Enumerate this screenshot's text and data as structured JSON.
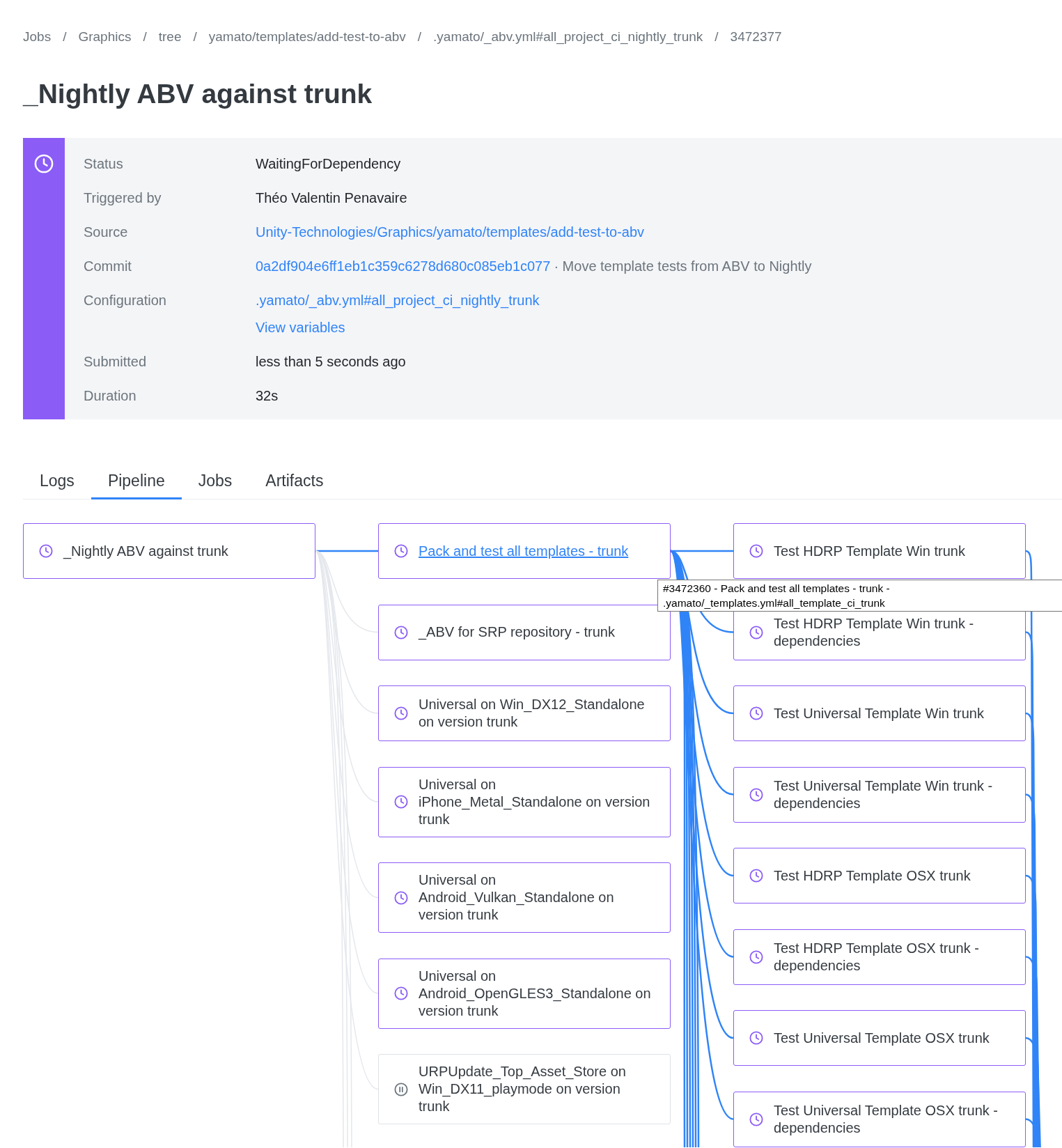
{
  "breadcrumb": [
    {
      "label": "Jobs"
    },
    {
      "separator": "/",
      "label": "Graphics"
    },
    {
      "separator": "/",
      "label": "tree"
    },
    {
      "separator": "/",
      "label": "yamato/templates/add-test-to-abv"
    },
    {
      "separator": "/",
      "label": ".yamato/_abv.yml#all_project_ci_nightly_trunk"
    },
    {
      "separator": "/",
      "label": "3472377"
    }
  ],
  "title": "_Nightly ABV against trunk",
  "summary": {
    "kind": "waiting",
    "rows": [
      {
        "label": "Status",
        "parts": [
          {
            "kind": "text",
            "text": "WaitingForDependency"
          }
        ]
      },
      {
        "label": "Triggered by",
        "parts": [
          {
            "kind": "text",
            "text": "Théo Valentin Penavaire"
          }
        ]
      },
      {
        "label": "Source",
        "parts": [
          {
            "kind": "link",
            "text": "Unity-Technologies/Graphics/yamato/templates/add-test-to-abv"
          }
        ]
      },
      {
        "label": "Commit",
        "parts": [
          {
            "kind": "link",
            "text": "0a2df904e6ff1eb1c359c6278d680c085eb1c077"
          },
          {
            "kind": "note",
            "text": "· Move template tests from ABV to Nightly"
          }
        ]
      },
      {
        "label": "Configuration",
        "parts": [
          {
            "kind": "link",
            "text": ".yamato/_abv.yml#all_project_ci_nightly_trunk"
          },
          {
            "kind": "link_below",
            "text": "View variables"
          }
        ]
      },
      {
        "label": "Submitted",
        "parts": [
          {
            "kind": "text",
            "text": "less than 5 seconds ago"
          }
        ]
      },
      {
        "label": "Duration",
        "parts": [
          {
            "kind": "text",
            "text": "32s"
          }
        ]
      }
    ]
  },
  "tabs": [
    {
      "label": "Logs",
      "selected": false
    },
    {
      "label": "Pipeline",
      "selected": true
    },
    {
      "label": "Jobs",
      "selected": false
    },
    {
      "label": "Artifacts",
      "selected": false
    }
  ],
  "pipeline": {
    "columns": [
      {
        "nodes": [
          {
            "label": "_Nightly ABV against trunk",
            "kind": "waiting",
            "highlighted": false
          }
        ]
      },
      {
        "nodes": [
          {
            "label": "Pack and test all templates - trunk",
            "kind": "waiting",
            "highlighted": true
          },
          {
            "label": "_ABV for SRP repository - trunk",
            "kind": "waiting",
            "highlighted": false
          },
          {
            "label": "Universal on Win_DX12_Standalone on version trunk",
            "kind": "waiting",
            "highlighted": false
          },
          {
            "label": "Universal on iPhone_Metal_Standalone on version trunk",
            "kind": "waiting",
            "highlighted": false
          },
          {
            "label": "Universal on Android_Vulkan_Standalone on version trunk",
            "kind": "waiting",
            "highlighted": false
          },
          {
            "label": "Universal on Android_OpenGLES3_Standalone on version trunk",
            "kind": "waiting",
            "highlighted": false
          },
          {
            "label": "URPUpdate_Top_Asset_Store on Win_DX11_playmode on version trunk",
            "kind": "paused",
            "highlighted": false
          }
        ]
      },
      {
        "nodes": [
          {
            "label": "Test HDRP Template Win trunk",
            "kind": "waiting",
            "highlighted": false
          },
          {
            "label": "Test HDRP Template Win trunk - dependencies",
            "kind": "waiting",
            "highlighted": false
          },
          {
            "label": "Test Universal Template Win trunk",
            "kind": "waiting",
            "highlighted": false
          },
          {
            "label": "Test Universal Template Win trunk - dependencies",
            "kind": "waiting",
            "highlighted": false
          },
          {
            "label": "Test HDRP Template OSX trunk",
            "kind": "waiting",
            "highlighted": false
          },
          {
            "label": "Test HDRP Template OSX trunk - dependencies",
            "kind": "waiting",
            "highlighted": false
          },
          {
            "label": "Test Universal Template OSX trunk",
            "kind": "waiting",
            "highlighted": false
          },
          {
            "label": "Test Universal Template OSX trunk - dependencies",
            "kind": "waiting",
            "highlighted": false
          }
        ]
      }
    ],
    "tooltip": {
      "text": "#3472360 - Pack and test all templates - trunk - .yamato/_templates.yml#all_template_ci_trunk"
    }
  }
}
